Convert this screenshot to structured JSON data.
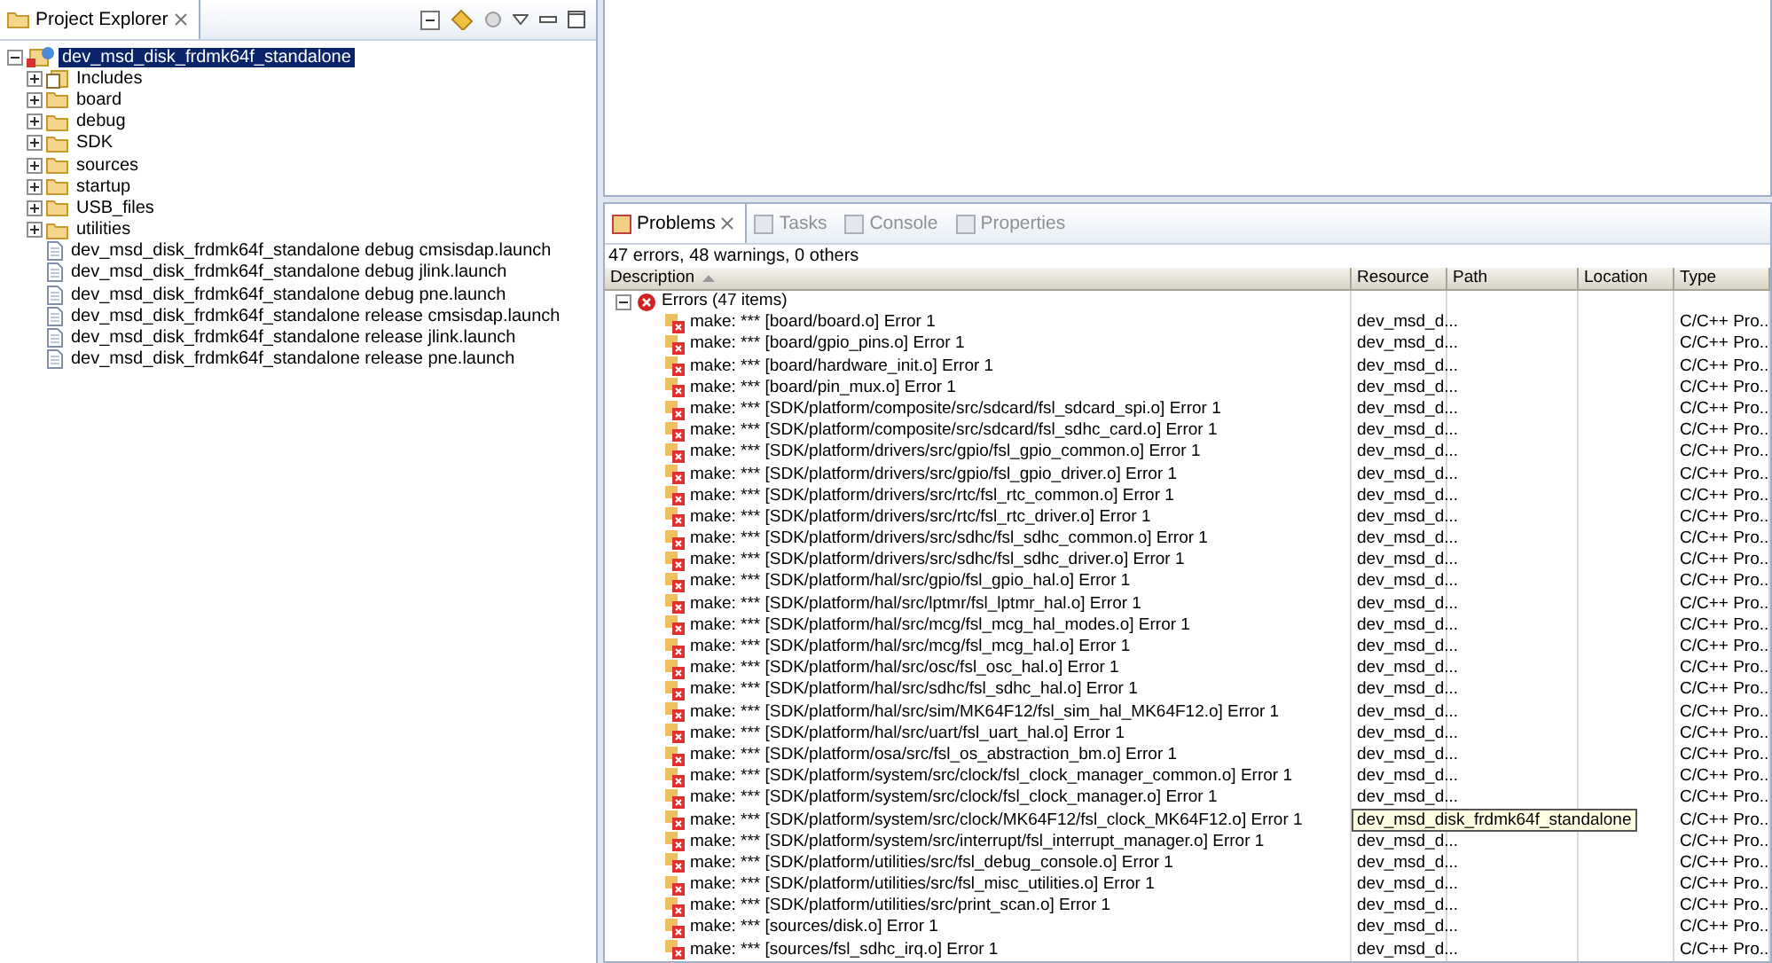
{
  "explorer": {
    "title": "Project Explorer",
    "tree": {
      "label": "dev_msd_disk_frdmk64f_standalone",
      "kind": "project",
      "expanded": true,
      "selected": true,
      "children": [
        {
          "label": "Includes",
          "kind": "include",
          "expanded": false
        },
        {
          "label": "board",
          "kind": "folder",
          "expanded": false
        },
        {
          "label": "debug",
          "kind": "folder",
          "expanded": false
        },
        {
          "label": "SDK",
          "kind": "folder",
          "expanded": false
        },
        {
          "label": "sources",
          "kind": "folder",
          "expanded": false
        },
        {
          "label": "startup",
          "kind": "folder",
          "expanded": false
        },
        {
          "label": "USB_files",
          "kind": "folder",
          "expanded": false
        },
        {
          "label": "utilities",
          "kind": "folder",
          "expanded": false
        },
        {
          "label": "dev_msd_disk_frdmk64f_standalone debug cmsisdap.launch",
          "kind": "file"
        },
        {
          "label": "dev_msd_disk_frdmk64f_standalone debug jlink.launch",
          "kind": "file"
        },
        {
          "label": "dev_msd_disk_frdmk64f_standalone debug pne.launch",
          "kind": "file"
        },
        {
          "label": "dev_msd_disk_frdmk64f_standalone release cmsisdap.launch",
          "kind": "file"
        },
        {
          "label": "dev_msd_disk_frdmk64f_standalone release jlink.launch",
          "kind": "file"
        },
        {
          "label": "dev_msd_disk_frdmk64f_standalone release pne.launch",
          "kind": "file"
        }
      ]
    }
  },
  "problems": {
    "tabs": [
      {
        "label": "Problems",
        "selected": true
      },
      {
        "label": "Tasks",
        "selected": false
      },
      {
        "label": "Console",
        "selected": false
      },
      {
        "label": "Properties",
        "selected": false
      }
    ],
    "summary": "47 errors, 48 warnings, 0 others",
    "columns": [
      "Description",
      "Resource",
      "Path",
      "Location",
      "Type"
    ],
    "group": {
      "label": "Errors (47 items)",
      "expanded": true
    },
    "rows": [
      {
        "description": "make: *** [board/board.o] Error 1",
        "resource": "dev_msd_d...",
        "type": "C/C++ Pro..."
      },
      {
        "description": "make: *** [board/gpio_pins.o] Error 1",
        "resource": "dev_msd_d...",
        "type": "C/C++ Pro..."
      },
      {
        "description": "make: *** [board/hardware_init.o] Error 1",
        "resource": "dev_msd_d...",
        "type": "C/C++ Pro..."
      },
      {
        "description": "make: *** [board/pin_mux.o] Error 1",
        "resource": "dev_msd_d...",
        "type": "C/C++ Pro..."
      },
      {
        "description": "make: *** [SDK/platform/composite/src/sdcard/fsl_sdcard_spi.o] Error 1",
        "resource": "dev_msd_d...",
        "type": "C/C++ Pro..."
      },
      {
        "description": "make: *** [SDK/platform/composite/src/sdcard/fsl_sdhc_card.o] Error 1",
        "resource": "dev_msd_d...",
        "type": "C/C++ Pro..."
      },
      {
        "description": "make: *** [SDK/platform/drivers/src/gpio/fsl_gpio_common.o] Error 1",
        "resource": "dev_msd_d...",
        "type": "C/C++ Pro..."
      },
      {
        "description": "make: *** [SDK/platform/drivers/src/gpio/fsl_gpio_driver.o] Error 1",
        "resource": "dev_msd_d...",
        "type": "C/C++ Pro..."
      },
      {
        "description": "make: *** [SDK/platform/drivers/src/rtc/fsl_rtc_common.o] Error 1",
        "resource": "dev_msd_d...",
        "type": "C/C++ Pro..."
      },
      {
        "description": "make: *** [SDK/platform/drivers/src/rtc/fsl_rtc_driver.o] Error 1",
        "resource": "dev_msd_d...",
        "type": "C/C++ Pro..."
      },
      {
        "description": "make: *** [SDK/platform/drivers/src/sdhc/fsl_sdhc_common.o] Error 1",
        "resource": "dev_msd_d...",
        "type": "C/C++ Pro..."
      },
      {
        "description": "make: *** [SDK/platform/drivers/src/sdhc/fsl_sdhc_driver.o] Error 1",
        "resource": "dev_msd_d...",
        "type": "C/C++ Pro..."
      },
      {
        "description": "make: *** [SDK/platform/hal/src/gpio/fsl_gpio_hal.o] Error 1",
        "resource": "dev_msd_d...",
        "type": "C/C++ Pro..."
      },
      {
        "description": "make: *** [SDK/platform/hal/src/lptmr/fsl_lptmr_hal.o] Error 1",
        "resource": "dev_msd_d...",
        "type": "C/C++ Pro..."
      },
      {
        "description": "make: *** [SDK/platform/hal/src/mcg/fsl_mcg_hal_modes.o] Error 1",
        "resource": "dev_msd_d...",
        "type": "C/C++ Pro..."
      },
      {
        "description": "make: *** [SDK/platform/hal/src/mcg/fsl_mcg_hal.o] Error 1",
        "resource": "dev_msd_d...",
        "type": "C/C++ Pro..."
      },
      {
        "description": "make: *** [SDK/platform/hal/src/osc/fsl_osc_hal.o] Error 1",
        "resource": "dev_msd_d...",
        "type": "C/C++ Pro..."
      },
      {
        "description": "make: *** [SDK/platform/hal/src/sdhc/fsl_sdhc_hal.o] Error 1",
        "resource": "dev_msd_d...",
        "type": "C/C++ Pro..."
      },
      {
        "description": "make: *** [SDK/platform/hal/src/sim/MK64F12/fsl_sim_hal_MK64F12.o] Error 1",
        "resource": "dev_msd_d...",
        "type": "C/C++ Pro..."
      },
      {
        "description": "make: *** [SDK/platform/hal/src/uart/fsl_uart_hal.o] Error 1",
        "resource": "dev_msd_d...",
        "type": "C/C++ Pro..."
      },
      {
        "description": "make: *** [SDK/platform/osa/src/fsl_os_abstraction_bm.o] Error 1",
        "resource": "dev_msd_d...",
        "type": "C/C++ Pro..."
      },
      {
        "description": "make: *** [SDK/platform/system/src/clock/fsl_clock_manager_common.o] Error 1",
        "resource": "dev_msd_d...",
        "type": "C/C++ Pro..."
      },
      {
        "description": "make: *** [SDK/platform/system/src/clock/fsl_clock_manager.o] Error 1",
        "resource": "dev_msd_d...",
        "type": "C/C++ Pro..."
      },
      {
        "description": "make: *** [SDK/platform/system/src/clock/MK64F12/fsl_clock_MK64F12.o] Error 1",
        "tooltip": "dev_msd_disk_frdmk64f_standalone",
        "type": "C/C++ Pro..."
      },
      {
        "description": "make: *** [SDK/platform/system/src/interrupt/fsl_interrupt_manager.o] Error 1",
        "resource": "dev_msd_d...",
        "type": "C/C++ Pro..."
      },
      {
        "description": "make: *** [SDK/platform/utilities/src/fsl_debug_console.o] Error 1",
        "resource": "dev_msd_d...",
        "type": "C/C++ Pro..."
      },
      {
        "description": "make: *** [SDK/platform/utilities/src/fsl_misc_utilities.o] Error 1",
        "resource": "dev_msd_d...",
        "type": "C/C++ Pro..."
      },
      {
        "description": "make: *** [SDK/platform/utilities/src/print_scan.o] Error 1",
        "resource": "dev_msd_d...",
        "type": "C/C++ Pro..."
      },
      {
        "description": "make: *** [sources/disk.o] Error 1",
        "resource": "dev_msd_d...",
        "type": "C/C++ Pro..."
      },
      {
        "description": "make: *** [sources/fsl_sdhc_irq.o] Error 1",
        "resource": "dev_msd_d...",
        "type": "C/C++ Pro..."
      }
    ]
  }
}
